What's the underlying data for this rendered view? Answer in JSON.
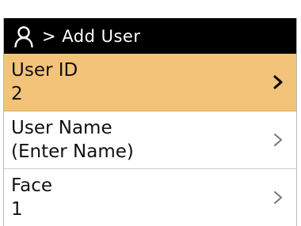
{
  "header": {
    "icon": "user-icon",
    "title": "> Add User",
    "background": "#000000"
  },
  "rows": [
    {
      "label": "User ID",
      "value": "2",
      "icon": "chevron-right-icon",
      "selected": true
    },
    {
      "label": "User Name",
      "value": "(Enter Name)",
      "icon": "chevron-right-icon",
      "selected": false
    },
    {
      "label": "Face",
      "value": "1",
      "icon": "chevron-right-icon",
      "selected": false
    }
  ],
  "colors": {
    "selected_row": "#f3c37a",
    "header_bg": "#000000",
    "text": "#111111",
    "chevron_selected": "#000000",
    "chevron_default": "#777777"
  }
}
